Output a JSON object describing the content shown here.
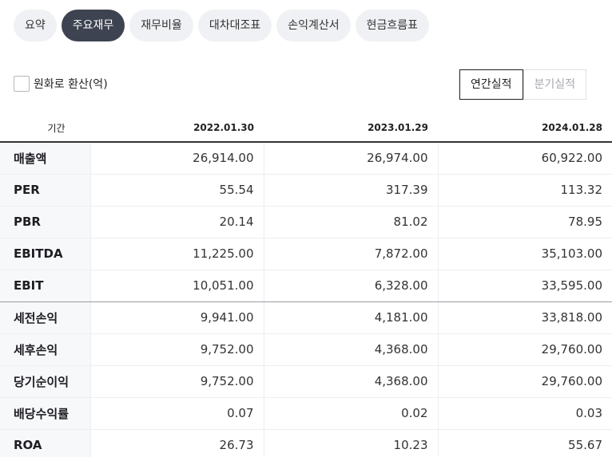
{
  "tabs": [
    {
      "label": "요약",
      "active": false
    },
    {
      "label": "주요재무",
      "active": true
    },
    {
      "label": "재무비율",
      "active": false
    },
    {
      "label": "대차대조표",
      "active": false
    },
    {
      "label": "손익계산서",
      "active": false
    },
    {
      "label": "현금흐름표",
      "active": false
    }
  ],
  "convert": {
    "label": "원화로 환산(억)",
    "checked": false
  },
  "period": {
    "annual": "연간실적",
    "quarterly": "분기실적",
    "selected": "annual"
  },
  "table": {
    "headers": [
      "기간",
      "2022.01.30",
      "2023.01.29",
      "2024.01.28"
    ],
    "rows": [
      {
        "label": "매출액",
        "values": [
          "26,914.00",
          "26,974.00",
          "60,922.00"
        ]
      },
      {
        "label": "PER",
        "values": [
          "55.54",
          "317.39",
          "113.32"
        ]
      },
      {
        "label": "PBR",
        "values": [
          "20.14",
          "81.02",
          "78.95"
        ]
      },
      {
        "label": "EBITDA",
        "values": [
          "11,225.00",
          "7,872.00",
          "35,103.00"
        ]
      },
      {
        "label": "EBIT",
        "values": [
          "10,051.00",
          "6,328.00",
          "33,595.00"
        ]
      },
      {
        "label": "세전손익",
        "values": [
          "9,941.00",
          "4,181.00",
          "33,818.00"
        ]
      },
      {
        "label": "세후손익",
        "values": [
          "9,752.00",
          "4,368.00",
          "29,760.00"
        ]
      },
      {
        "label": "당기순이익",
        "values": [
          "9,752.00",
          "4,368.00",
          "29,760.00"
        ]
      },
      {
        "label": "배당수익률",
        "values": [
          "0.07",
          "0.02",
          "0.03"
        ]
      },
      {
        "label": "ROA",
        "values": [
          "26.73",
          "10.23",
          "55.67"
        ]
      }
    ]
  }
}
